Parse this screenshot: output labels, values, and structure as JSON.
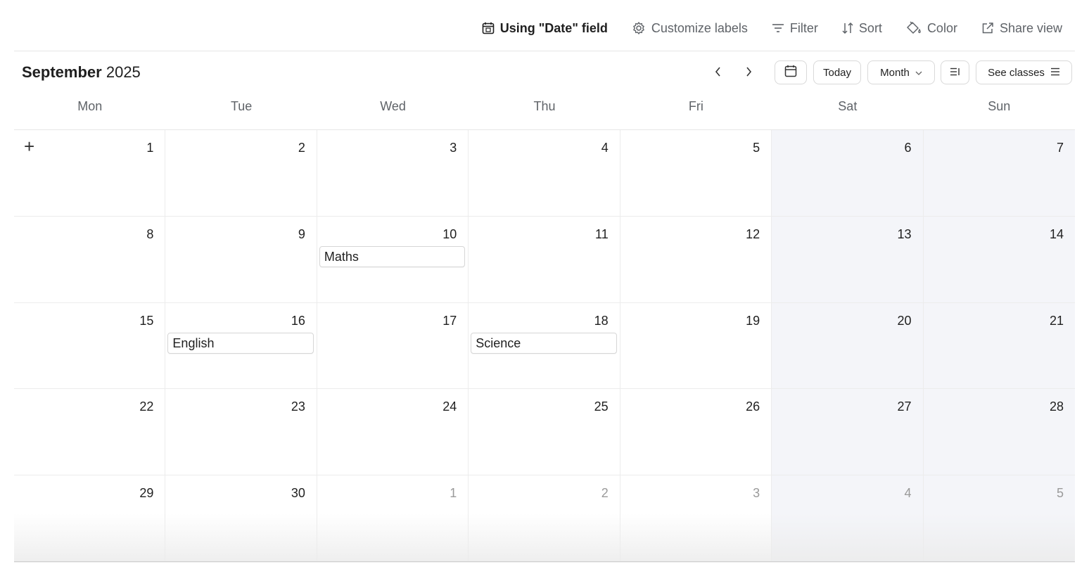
{
  "toolbar": {
    "date_field": "Using \"Date\" field",
    "customize_labels": "Customize labels",
    "filter": "Filter",
    "sort": "Sort",
    "color": "Color",
    "share_view": "Share view"
  },
  "header": {
    "month": "September",
    "year": "2025",
    "today_label": "Today",
    "view_label": "Month",
    "see_classes_label": "See classes"
  },
  "weekdays": [
    "Mon",
    "Tue",
    "Wed",
    "Thu",
    "Fri",
    "Sat",
    "Sun"
  ],
  "weeks": [
    [
      {
        "day": "1"
      },
      {
        "day": "2"
      },
      {
        "day": "3"
      },
      {
        "day": "4"
      },
      {
        "day": "5"
      },
      {
        "day": "6"
      },
      {
        "day": "7"
      }
    ],
    [
      {
        "day": "8"
      },
      {
        "day": "9"
      },
      {
        "day": "10",
        "event": "Maths"
      },
      {
        "day": "11"
      },
      {
        "day": "12"
      },
      {
        "day": "13"
      },
      {
        "day": "14"
      }
    ],
    [
      {
        "day": "15"
      },
      {
        "day": "16",
        "event": "English"
      },
      {
        "day": "17"
      },
      {
        "day": "18",
        "event": "Science"
      },
      {
        "day": "19"
      },
      {
        "day": "20"
      },
      {
        "day": "21"
      }
    ],
    [
      {
        "day": "22"
      },
      {
        "day": "23"
      },
      {
        "day": "24"
      },
      {
        "day": "25"
      },
      {
        "day": "26"
      },
      {
        "day": "27"
      },
      {
        "day": "28"
      }
    ],
    [
      {
        "day": "29"
      },
      {
        "day": "30"
      },
      {
        "day": "1",
        "other": true
      },
      {
        "day": "2",
        "other": true
      },
      {
        "day": "3",
        "other": true
      },
      {
        "day": "4",
        "other": true
      },
      {
        "day": "5",
        "other": true
      }
    ]
  ],
  "add_symbol": "+"
}
